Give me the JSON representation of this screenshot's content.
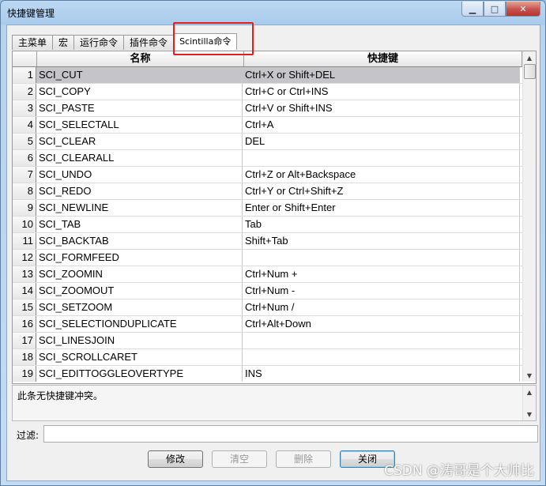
{
  "window": {
    "title": "快捷键管理",
    "controls": {
      "minimize": "▁",
      "maximize": "□",
      "close": "✕"
    }
  },
  "tabs": [
    {
      "label": "主菜单",
      "active": false
    },
    {
      "label": "宏",
      "active": false
    },
    {
      "label": "运行命令",
      "active": false
    },
    {
      "label": "插件命令",
      "active": false
    },
    {
      "label": "Scintilla命令",
      "active": true
    }
  ],
  "table": {
    "headers": {
      "name": "名称",
      "shortcut": "快捷键"
    },
    "selected_row": 1,
    "rows": [
      {
        "num": "1",
        "name": "SCI_CUT",
        "shortcut": "Ctrl+X or Shift+DEL"
      },
      {
        "num": "2",
        "name": "SCI_COPY",
        "shortcut": "Ctrl+C or Ctrl+INS"
      },
      {
        "num": "3",
        "name": "SCI_PASTE",
        "shortcut": "Ctrl+V or Shift+INS"
      },
      {
        "num": "4",
        "name": "SCI_SELECTALL",
        "shortcut": "Ctrl+A"
      },
      {
        "num": "5",
        "name": "SCI_CLEAR",
        "shortcut": "DEL"
      },
      {
        "num": "6",
        "name": "SCI_CLEARALL",
        "shortcut": ""
      },
      {
        "num": "7",
        "name": "SCI_UNDO",
        "shortcut": "Ctrl+Z or Alt+Backspace"
      },
      {
        "num": "8",
        "name": "SCI_REDO",
        "shortcut": "Ctrl+Y or Ctrl+Shift+Z"
      },
      {
        "num": "9",
        "name": "SCI_NEWLINE",
        "shortcut": "Enter or Shift+Enter"
      },
      {
        "num": "10",
        "name": "SCI_TAB",
        "shortcut": "Tab"
      },
      {
        "num": "11",
        "name": "SCI_BACKTAB",
        "shortcut": "Shift+Tab"
      },
      {
        "num": "12",
        "name": "SCI_FORMFEED",
        "shortcut": ""
      },
      {
        "num": "13",
        "name": "SCI_ZOOMIN",
        "shortcut": "Ctrl+Num +"
      },
      {
        "num": "14",
        "name": "SCI_ZOOMOUT",
        "shortcut": "Ctrl+Num -"
      },
      {
        "num": "15",
        "name": "SCI_SETZOOM",
        "shortcut": "Ctrl+Num /"
      },
      {
        "num": "16",
        "name": "SCI_SELECTIONDUPLICATE",
        "shortcut": "Ctrl+Alt+Down"
      },
      {
        "num": "17",
        "name": "SCI_LINESJOIN",
        "shortcut": ""
      },
      {
        "num": "18",
        "name": "SCI_SCROLLCARET",
        "shortcut": ""
      },
      {
        "num": "19",
        "name": "SCI_EDITTOGGLEOVERTYPE",
        "shortcut": "INS"
      }
    ]
  },
  "conflict_info": "此条无快捷键冲突。",
  "filter": {
    "label": "过滤:",
    "value": ""
  },
  "buttons": {
    "modify": "修改",
    "clear": "清空",
    "delete": "删除",
    "close": "关闭"
  },
  "watermark": "CSDN @涛哥是个大帅比",
  "colors": {
    "selected_row": "#c4c4c9",
    "highlight_box": "#e02020",
    "title_bar": "#b9d5f0"
  }
}
